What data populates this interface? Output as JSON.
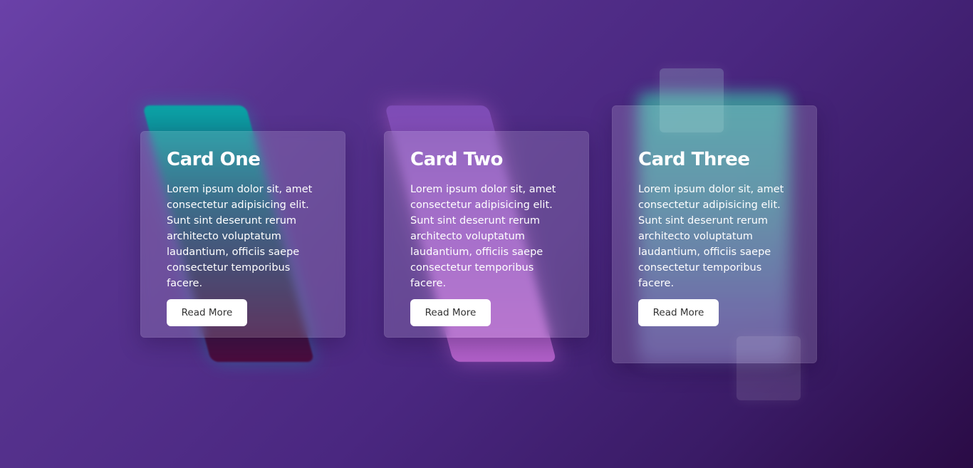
{
  "cards": [
    {
      "title": "Card One",
      "text": "Lorem ipsum dolor sit, amet consectetur adipisicing elit. Sunt sint deserunt rerum architecto voluptatum laudantium, officiis saepe consectetur temporibus facere.",
      "button_label": "Read More"
    },
    {
      "title": "Card Two",
      "text": "Lorem ipsum dolor sit, amet consectetur adipisicing elit. Sunt sint deserunt rerum architecto voluptatum laudantium, officiis saepe consectetur temporibus facere.",
      "button_label": "Read More"
    },
    {
      "title": "Card Three",
      "text": "Lorem ipsum dolor sit, amet consectetur adipisicing elit. Sunt sint deserunt rerum architecto voluptatum laudantium, officiis saepe consectetur temporibus facere.",
      "button_label": "Read More"
    }
  ],
  "colors": {
    "background_start": "#6a41a8",
    "background_end": "#2a0b45",
    "button_bg": "#ffffff",
    "button_text": "#333333",
    "card_text": "#ffffff"
  }
}
